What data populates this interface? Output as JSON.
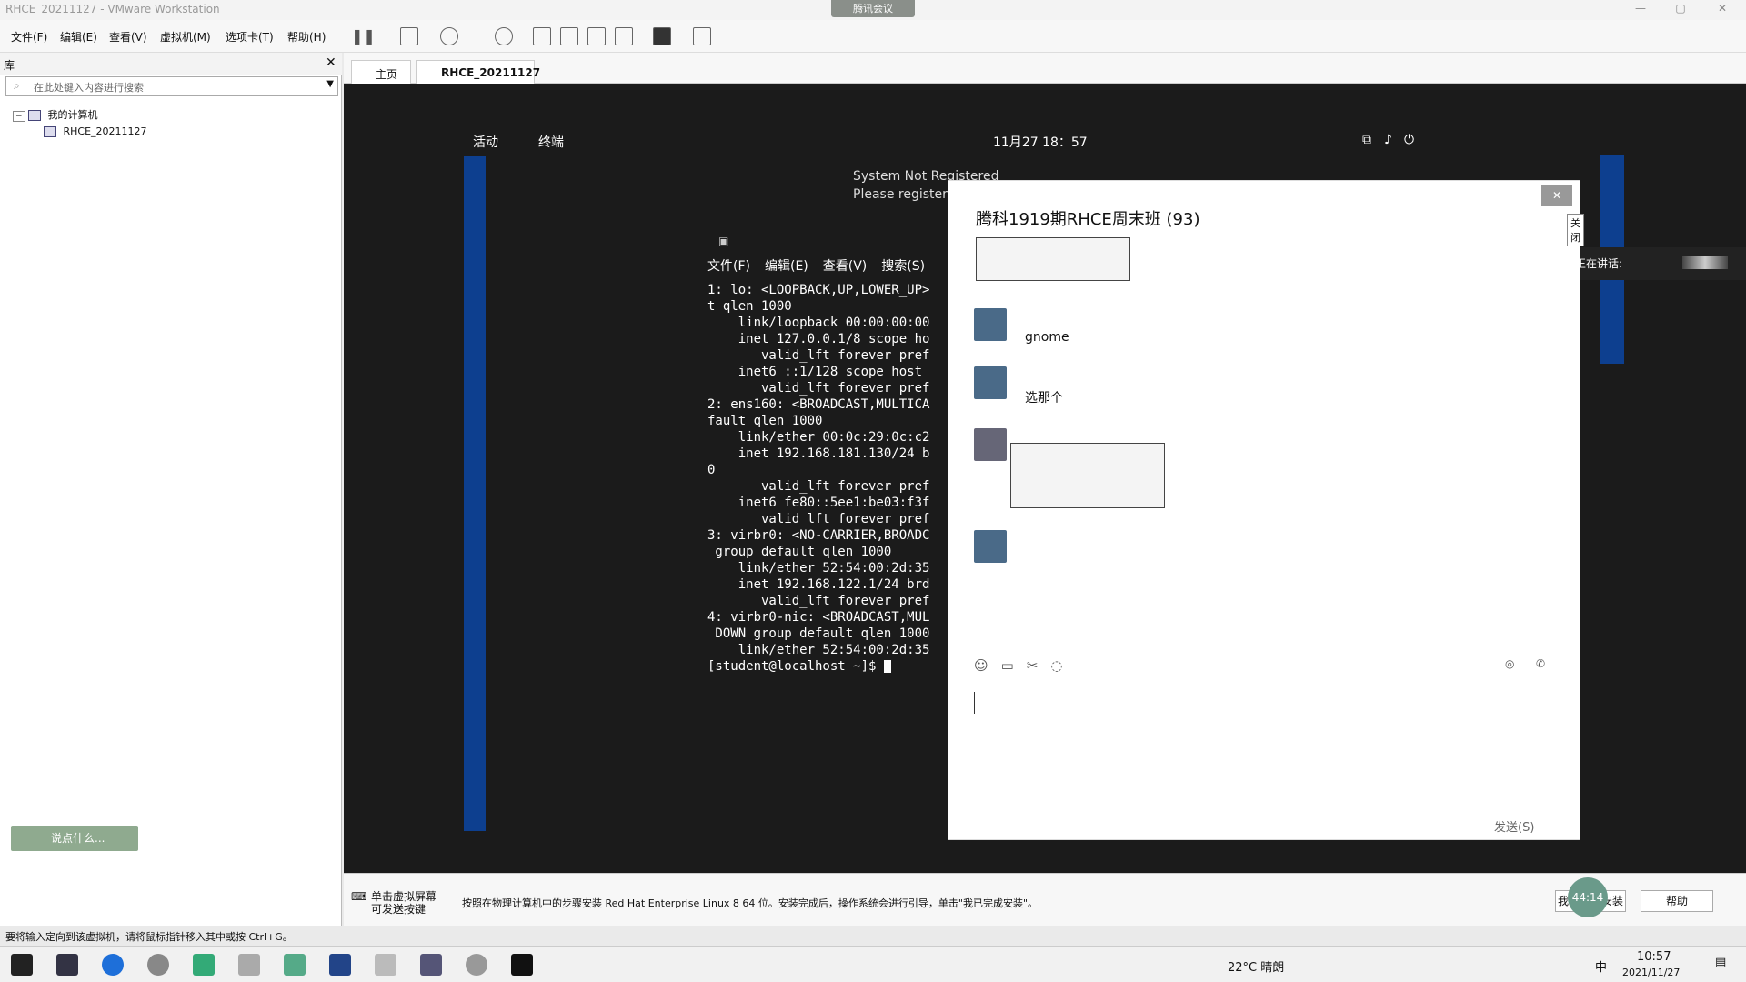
{
  "app": {
    "title": "RHCE_20211127 - VMware Workstation",
    "meeting_tab": "腾讯会议"
  },
  "menus": [
    "文件(F)",
    "编辑(E)",
    "查看(V)",
    "虚拟机(M)",
    "选项卡(T)",
    "帮助(H)"
  ],
  "library": {
    "header": "库",
    "search_placeholder": "在此处键入内容进行搜索",
    "root": "我的计算机",
    "vm": "RHCE_20211127",
    "talk": "说点什么..."
  },
  "tabs": [
    "主页",
    "RHCE_20211127"
  ],
  "vm": {
    "activities": "活动",
    "terminal": "终端",
    "clock": "11月27 18：57",
    "notice_title": "System Not Registered",
    "notice_body": "Please register y",
    "term_menus": [
      "文件(F)",
      "编辑(E)",
      "查看(V)",
      "搜索(S)"
    ],
    "term_lines": [
      "1: lo: <LOOPBACK,UP,LOWER_UP>",
      "t qlen 1000",
      "    link/loopback 00:00:00:00",
      "    inet 127.0.0.1/8 scope ho",
      "       valid_lft forever pref",
      "    inet6 ::1/128 scope host",
      "       valid_lft forever pref",
      "2: ens160: <BROADCAST,MULTICA",
      "fault qlen 1000",
      "    link/ether 00:0c:29:0c:c2",
      "    inet 192.168.181.130/24 b",
      "0",
      "       valid_lft forever pref",
      "    inet6 fe80::5ee1:be03:f3f",
      "       valid_lft forever pref",
      "3: virbr0: <NO-CARRIER,BROADC",
      " group default qlen 1000",
      "    link/ether 52:54:00:2d:35",
      "    inet 192.168.122.1/24 brd",
      "       valid_lft forever pref",
      "4: virbr0-nic: <BROADCAST,MUL",
      " DOWN group default qlen 1000",
      "    link/ether 52:54:00:2d:35",
      "[student@localhost ~]$ "
    ]
  },
  "chat": {
    "title": "腾科1919期RHCE周末班 (93)",
    "msgs": [
      "gnome",
      "选那个"
    ],
    "close_tip": "关闭",
    "send": "发送(S)",
    "speaking": "正在讲话:"
  },
  "status": {
    "click_hint": "单击虚拟屏幕\n可发送按键",
    "install_hint": "按照在物理计算机中的步骤安装 Red Hat Enterprise Linux 8 64 位。安装完成后，操作系统会进行引导，单击\"我已完成安装\"。",
    "btn_done": "我已完成安装",
    "btn_help": "帮助",
    "timer": "44:14",
    "bottom_hint": "要将输入定向到该虚拟机，请将鼠标指针移入其中或按 Ctrl+G。"
  },
  "taskbar": {
    "weather": "22°C 晴朗",
    "ime": "中",
    "time": "10:57",
    "date": "2021/11/27"
  }
}
